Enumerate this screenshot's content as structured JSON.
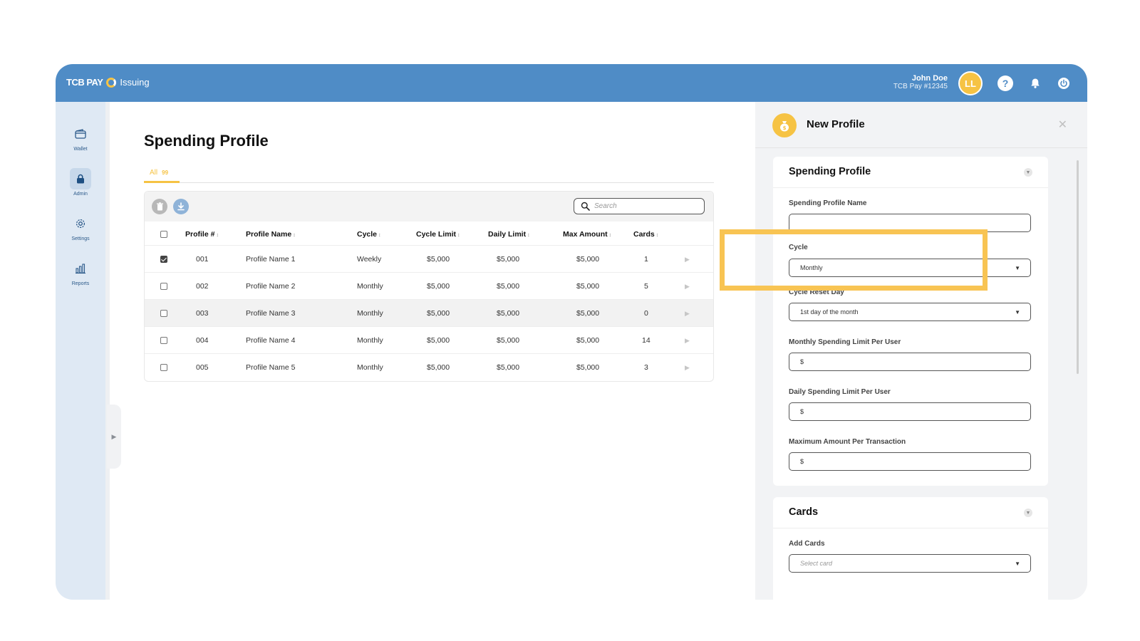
{
  "brand": {
    "name": "TCB PAY",
    "product": "Issuing"
  },
  "user": {
    "name": "John Doe",
    "account": "TCB Pay #12345",
    "initials": "LL"
  },
  "sidebar": {
    "items": [
      {
        "label": "Wallet",
        "icon": "wallet-icon"
      },
      {
        "label": "Admin",
        "icon": "lock-icon"
      },
      {
        "label": "Settings",
        "icon": "gear-icon"
      },
      {
        "label": "Reports",
        "icon": "bar-chart-icon"
      }
    ]
  },
  "main": {
    "title": "Spending Profile",
    "tab": {
      "label": "All",
      "count": "99"
    },
    "search_placeholder": "Search",
    "columns": [
      "Profile #",
      "Profile Name",
      "Cycle",
      "Cycle Limit",
      "Daily Limit",
      "Max Amount",
      "Cards"
    ],
    "rows": [
      {
        "id": "001",
        "name": "Profile Name 1",
        "cycle": "Weekly",
        "cycle_limit": "$5,000",
        "daily_limit": "$5,000",
        "max_amount": "$5,000",
        "cards": "1",
        "checked": true
      },
      {
        "id": "002",
        "name": "Profile Name 2",
        "cycle": "Monthly",
        "cycle_limit": "$5,000",
        "daily_limit": "$5,000",
        "max_amount": "$5,000",
        "cards": "5",
        "checked": false
      },
      {
        "id": "003",
        "name": "Profile Name 3",
        "cycle": "Monthly",
        "cycle_limit": "$5,000",
        "daily_limit": "$5,000",
        "max_amount": "$5,000",
        "cards": "0",
        "checked": false
      },
      {
        "id": "004",
        "name": "Profile Name 4",
        "cycle": "Monthly",
        "cycle_limit": "$5,000",
        "daily_limit": "$5,000",
        "max_amount": "$5,000",
        "cards": "14",
        "checked": false
      },
      {
        "id": "005",
        "name": "Profile Name 5",
        "cycle": "Monthly",
        "cycle_limit": "$5,000",
        "daily_limit": "$5,000",
        "max_amount": "$5,000",
        "cards": "3",
        "checked": false
      }
    ]
  },
  "panel": {
    "title": "New Profile",
    "section1": {
      "title": "Spending Profile",
      "fields": {
        "profile_name_label": "Spending Profile Name",
        "profile_name_value": "",
        "cycle_label": "Cycle",
        "cycle_value": "Monthly",
        "reset_day_label": "Cycle Reset Day",
        "reset_day_value": "1st day of the month",
        "monthly_label": "Monthly Spending Limit Per User",
        "monthly_value": "$",
        "daily_label": "Daily Spending Limit Per User",
        "daily_value": "$",
        "max_label": "Maximum Amount Per Transaction",
        "max_value": "$"
      }
    },
    "section2": {
      "title": "Cards",
      "add_label": "Add Cards",
      "add_placeholder": "Select card"
    }
  },
  "colors": {
    "primary": "#4f8cc6",
    "accent": "#f6c344",
    "sidebar": "#dfe9f4"
  }
}
